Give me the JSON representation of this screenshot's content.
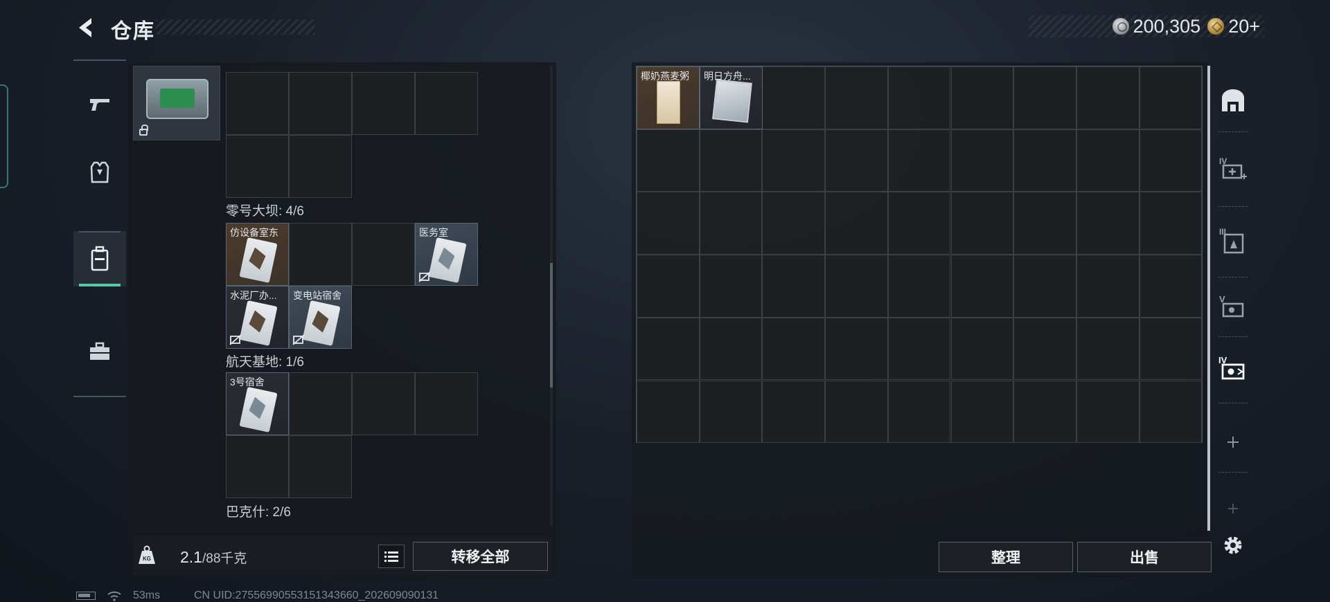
{
  "header": {
    "title": "仓库",
    "currency": [
      {
        "icon": "silver-coin-icon",
        "value": "200,305"
      },
      {
        "icon": "gold-coin-icon",
        "value": "20+"
      }
    ]
  },
  "categories": [
    {
      "name": "weapons",
      "icon": "pistol-icon"
    },
    {
      "name": "armor",
      "icon": "armor-vest-icon"
    },
    {
      "name": "containers",
      "icon": "backpack-icon",
      "active": true
    },
    {
      "name": "tools",
      "icon": "toolbox-icon"
    }
  ],
  "left": {
    "sections": [
      {
        "label": "零号大坝: 4/6",
        "items": []
      },
      {
        "label": "航天基地: 1/6",
        "items": [
          "仿设备室东",
          "医务室",
          "水泥厂办...",
          "变电站宿舍"
        ]
      },
      {
        "label": "巴克什: 2/6",
        "items": [
          "3号宿舍"
        ]
      }
    ],
    "weight_current": "2.1",
    "weight_max": "/88千克",
    "transfer_all": "转移全部"
  },
  "right": {
    "items": [
      "椰奶燕麦粥",
      "明日方舟..."
    ],
    "sort": "整理",
    "sell": "出售"
  },
  "tools": [
    "home-base-icon",
    "iv-plus-icon",
    "iii-storage-icon",
    "v-storage-icon",
    "iv-storage-icon",
    "add-icon",
    "add-faded-icon"
  ],
  "status": {
    "ping": "53ms",
    "uid": "CN UID:275569905531513436​60_202609090131"
  },
  "colors": {
    "accent": "#55c9a6",
    "orange_rarity": "#4b3b2c",
    "blue_rarity": "#3f4b57"
  }
}
